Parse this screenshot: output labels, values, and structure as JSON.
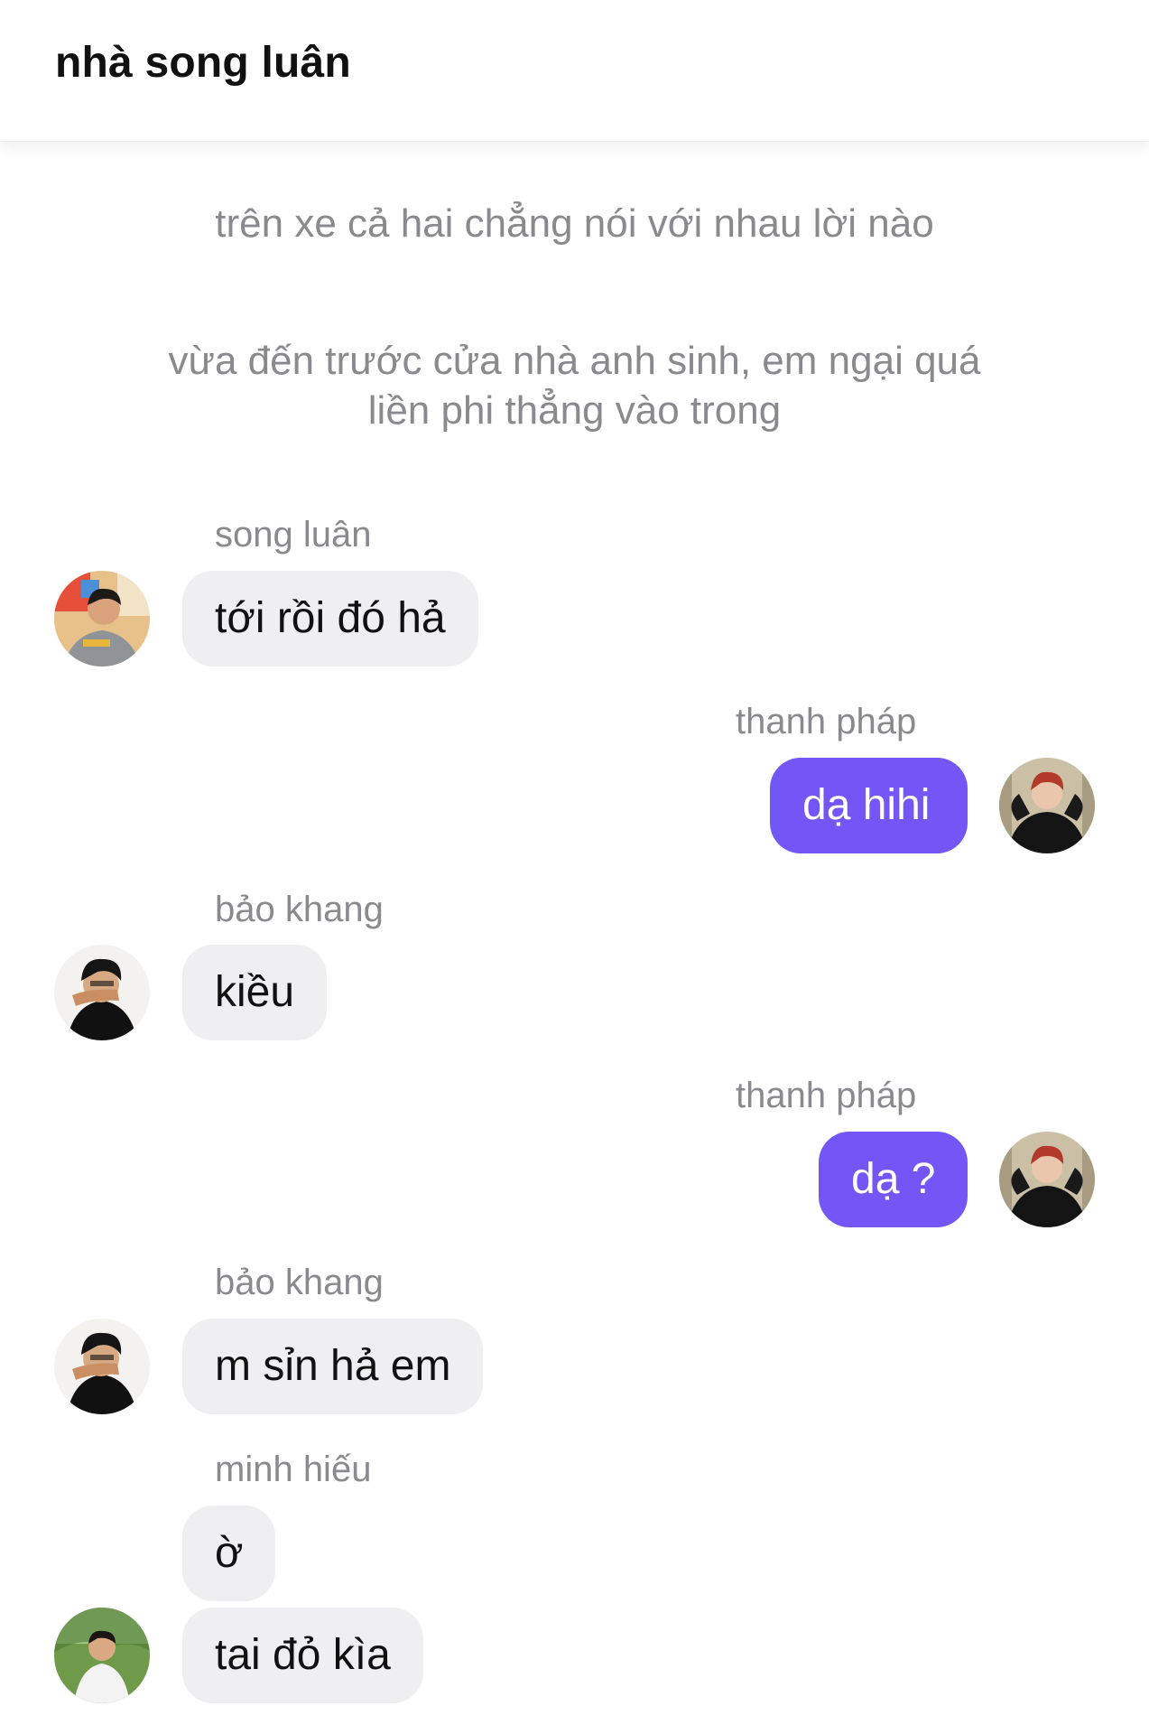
{
  "header": {
    "title": "nhà song luân"
  },
  "narration": [
    "trên xe cả hai chẳng nói với nhau lời nào",
    "vừa đến trước cửa nhà anh sinh, em ngại quá",
    "liền phi thẳng vào trong"
  ],
  "messages": [
    {
      "sender": "song luân",
      "text": "tới rồi đó hả",
      "direction": "incoming"
    },
    {
      "sender": "thanh pháp",
      "text": "dạ hihi",
      "direction": "outgoing"
    },
    {
      "sender": "bảo khang",
      "text": "kiều",
      "direction": "incoming"
    },
    {
      "sender": "thanh pháp",
      "text": "dạ ?",
      "direction": "outgoing"
    },
    {
      "sender": "bảo khang",
      "text": "m sỉn hả em",
      "direction": "incoming"
    },
    {
      "sender": "minh hiếu",
      "text": "ờ",
      "direction": "incoming"
    },
    {
      "sender": "minh hiếu",
      "text": "tai đỏ kìa",
      "direction": "incoming"
    }
  ],
  "colors": {
    "outgoing_bubble": "#7356f5",
    "incoming_bubble": "#efeff1",
    "sender_text": "#8a8a8e"
  },
  "avatars": [
    "song-luan-avatar",
    "thanh-phap-avatar",
    "bao-khang-avatar",
    "minh-hieu-avatar"
  ]
}
